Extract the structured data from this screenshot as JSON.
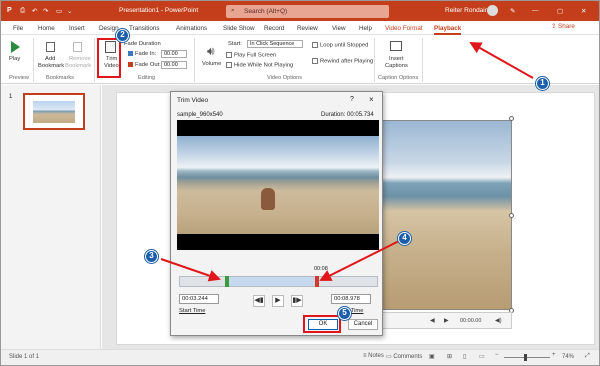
{
  "titlebar": {
    "file_name": "Presentation1 - PowerPoint",
    "search_placeholder": "Search (Alt+Q)",
    "user_name": "Reiter Rondain"
  },
  "tabs": [
    "File",
    "Home",
    "Insert",
    "Design",
    "Transitions",
    "Animations",
    "Slide Show",
    "Record",
    "Review",
    "View",
    "Help",
    "Video Format",
    "Playback"
  ],
  "share_label": "Share",
  "ribbon": {
    "play_label": "Play",
    "preview_group": "Preview",
    "add_bookmark_1": "Add",
    "add_bookmark_2": "Bookmark",
    "remove_bookmark_1": "Remove",
    "remove_bookmark_2": "Bookmark",
    "bookmarks_group": "Bookmarks",
    "trim_1": "Trim",
    "trim_2": "Video",
    "fade_duration": "Fade Duration",
    "fade_in": "Fade In:",
    "fade_in_value": "00.00",
    "fade_out": "Fade Out:",
    "fade_out_value": "00.00",
    "editing_group": "Editing",
    "volume": "Volume",
    "start_label": "Start:",
    "start_value": "In Click Sequence",
    "play_full_screen": "Play Full Screen",
    "hide_while": "Hide While Not Playing",
    "loop": "Loop until Stopped",
    "rewind": "Rewind after Playing",
    "video_options_group": "Video Options",
    "insert_captions_1": "Insert",
    "insert_captions_2": "Captions",
    "caption_options_group": "Caption Options"
  },
  "slide_number": "1",
  "dialog": {
    "title": "Trim Video",
    "help": "?",
    "close": "×",
    "file": "sample_960x540",
    "duration": "Duration: 00:05.734",
    "marker_time": "00:08",
    "start_value": "00:03.244",
    "start_label": "Start Time",
    "end_value": "00:08.978",
    "end_label": "End Time",
    "ok": "OK",
    "cancel": "Cancel"
  },
  "slide_player_time": "00:00.00",
  "callouts": [
    "1",
    "2",
    "3",
    "4",
    "5"
  ],
  "status": {
    "slide_info": "Slide 1 of 1",
    "notes": "Notes",
    "comments": "Comments",
    "zoom": "74%"
  },
  "colors": {
    "accent": "#c43e1c",
    "callout_blue": "#1c5fa8",
    "annotation_red": "#e0161a"
  }
}
